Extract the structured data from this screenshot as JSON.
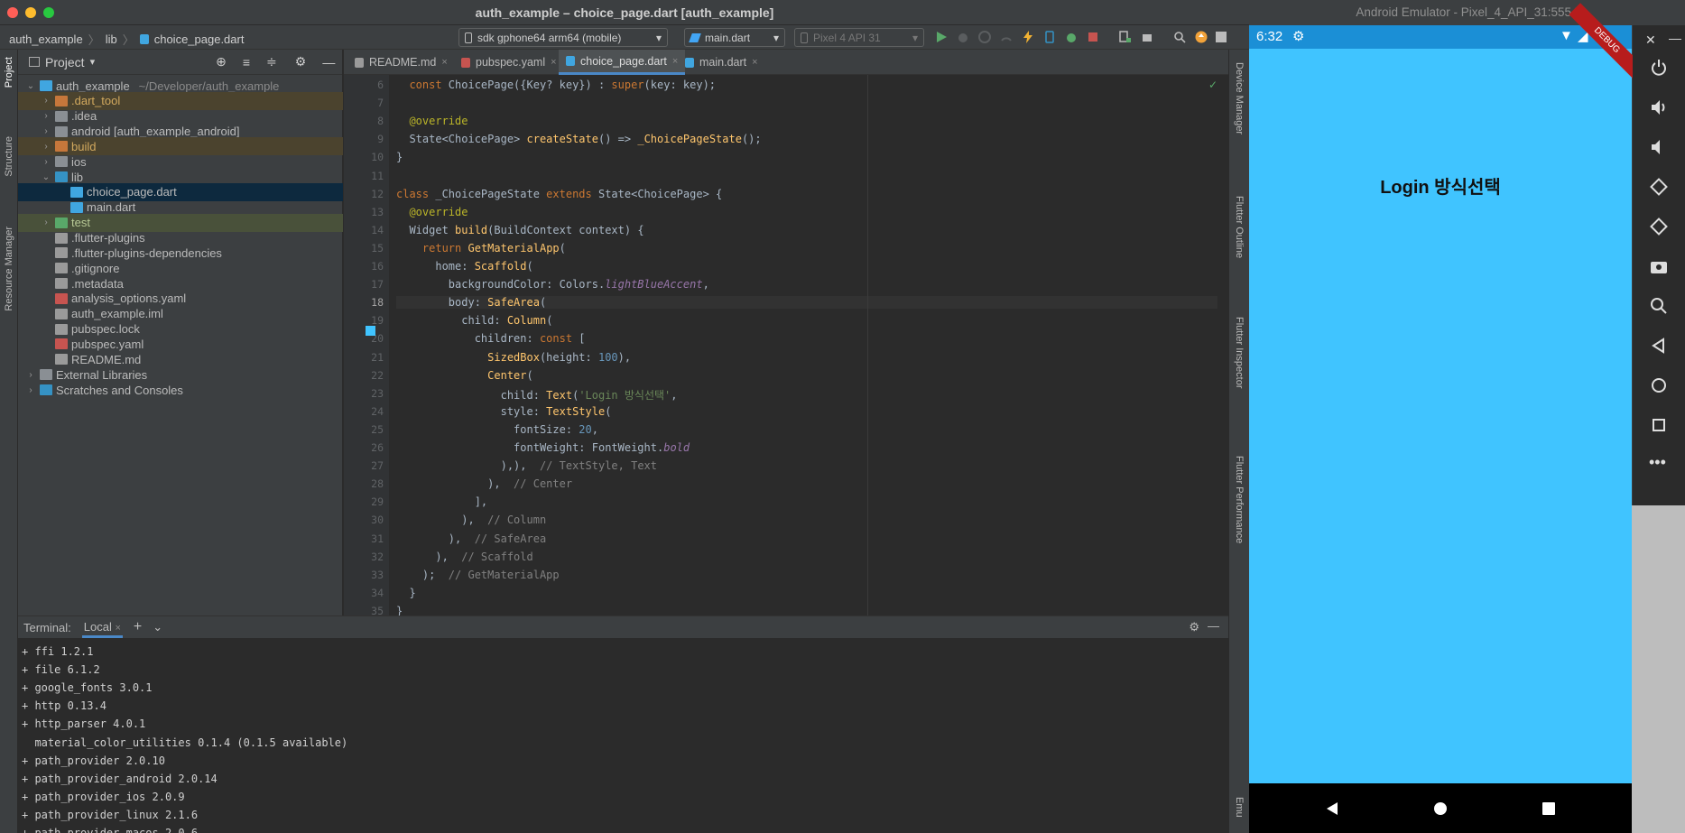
{
  "window": {
    "title": "auth_example – choice_page.dart [auth_example]"
  },
  "breadcrumb": [
    "auth_example",
    "lib",
    "choice_page.dart"
  ],
  "toolbar": {
    "device": "sdk gphone64 arm64 (mobile)",
    "run_config": "main.dart",
    "emulator": "Pixel 4 API 31"
  },
  "left_strip": {
    "project": "Project",
    "structure": "Structure",
    "resource_manager": "Resource Manager"
  },
  "right_strip": {
    "device_manager": "Device Manager",
    "flutter_outline": "Flutter Outline",
    "flutter_inspector": "Flutter Inspector",
    "flutter_performance": "Flutter Performance",
    "emulator": "Emu"
  },
  "project": {
    "header": "Project",
    "tree": [
      {
        "label": "auth_example",
        "extra": "~/Developer/auth_example",
        "level": 0,
        "arrow": "open",
        "icon": "module"
      },
      {
        "label": ".dart_tool",
        "level": 1,
        "arrow": "closed",
        "icon": "folder-orange"
      },
      {
        "label": ".idea",
        "level": 1,
        "arrow": "closed",
        "icon": "folder"
      },
      {
        "label": "android [auth_example_android]",
        "level": 1,
        "arrow": "closed",
        "icon": "folder"
      },
      {
        "label": "build",
        "level": 1,
        "arrow": "closed",
        "icon": "folder-orange"
      },
      {
        "label": "ios",
        "level": 1,
        "arrow": "closed",
        "icon": "folder"
      },
      {
        "label": "lib",
        "level": 1,
        "arrow": "open",
        "icon": "folder-blue"
      },
      {
        "label": "choice_page.dart",
        "level": 2,
        "arrow": "none",
        "icon": "dart"
      },
      {
        "label": "main.dart",
        "level": 2,
        "arrow": "none",
        "icon": "dart"
      },
      {
        "label": "test",
        "level": 1,
        "arrow": "closed",
        "icon": "folder-green"
      },
      {
        "label": ".flutter-plugins",
        "level": 1,
        "arrow": "none",
        "icon": "file"
      },
      {
        "label": ".flutter-plugins-dependencies",
        "level": 1,
        "arrow": "none",
        "icon": "file"
      },
      {
        "label": ".gitignore",
        "level": 1,
        "arrow": "none",
        "icon": "file"
      },
      {
        "label": ".metadata",
        "level": 1,
        "arrow": "none",
        "icon": "file"
      },
      {
        "label": "analysis_options.yaml",
        "level": 1,
        "arrow": "none",
        "icon": "yaml"
      },
      {
        "label": "auth_example.iml",
        "level": 1,
        "arrow": "none",
        "icon": "file"
      },
      {
        "label": "pubspec.lock",
        "level": 1,
        "arrow": "none",
        "icon": "file"
      },
      {
        "label": "pubspec.yaml",
        "level": 1,
        "arrow": "none",
        "icon": "yaml"
      },
      {
        "label": "README.md",
        "level": 1,
        "arrow": "none",
        "icon": "md"
      },
      {
        "label": "External Libraries",
        "level": 0,
        "arrow": "closed",
        "icon": "lib"
      },
      {
        "label": "Scratches and Consoles",
        "level": 0,
        "arrow": "closed",
        "icon": "scratch"
      }
    ]
  },
  "editor": {
    "tabs": [
      {
        "label": "README.md",
        "icon": "md"
      },
      {
        "label": "pubspec.yaml",
        "icon": "yaml"
      },
      {
        "label": "choice_page.dart",
        "icon": "dart"
      },
      {
        "label": "main.dart",
        "icon": "dart"
      }
    ],
    "active_tab": 2,
    "lines": [
      {
        "n": "6",
        "html": "  <span class=\"k\">const</span> ChoicePage({Key? key}) : <span class=\"k\">super</span>(key: key);"
      },
      {
        "n": "7",
        "html": ""
      },
      {
        "n": "8",
        "html": "  <span class=\"a\">@override</span>"
      },
      {
        "n": "9",
        "html": "  State&lt;ChoicePage&gt; <span class=\"f\">createState</span>() =&gt; <span class=\"f\">_ChoicePageState</span>();"
      },
      {
        "n": "10",
        "html": "}"
      },
      {
        "n": "11",
        "html": ""
      },
      {
        "n": "12",
        "html": "<span class=\"k\">class</span> _ChoicePageState <span class=\"k\">extends</span> State&lt;ChoicePage&gt; {"
      },
      {
        "n": "13",
        "html": "  <span class=\"a\">@override</span>"
      },
      {
        "n": "14",
        "html": "  Widget <span class=\"f\">build</span>(BuildContext context) {"
      },
      {
        "n": "15",
        "html": "    <span class=\"k\">return</span> <span class=\"f\">GetMaterialApp</span>("
      },
      {
        "n": "16",
        "html": "      home: <span class=\"f\">Scaffold</span>("
      },
      {
        "n": "17",
        "html": "        backgroundColor: Colors.<span class=\"p\">lightBlueAccent</span>,"
      },
      {
        "n": "18",
        "html": "        body: <span class=\"f\">SafeArea</span>("
      },
      {
        "n": "19",
        "html": "          child: <span class=\"f\">Column</span>("
      },
      {
        "n": "20",
        "html": "            children: <span class=\"k\">const</span> ["
      },
      {
        "n": "21",
        "html": "              <span class=\"f\">SizedBox</span>(height: <span class=\"n\">100</span>),"
      },
      {
        "n": "22",
        "html": "              <span class=\"f\">Center</span>("
      },
      {
        "n": "23",
        "html": "                child: <span class=\"f\">Text</span>(<span class=\"s\">'Login 방식선택'</span>,"
      },
      {
        "n": "24",
        "html": "                style: <span class=\"f\">TextStyle</span>("
      },
      {
        "n": "25",
        "html": "                  fontSize: <span class=\"n\">20</span>,"
      },
      {
        "n": "26",
        "html": "                  fontWeight: FontWeight.<span class=\"p\">bold</span>"
      },
      {
        "n": "27",
        "html": "                ),),  <span class=\"cm\">// TextStyle, Text</span>"
      },
      {
        "n": "28",
        "html": "              ),  <span class=\"cm\">// Center</span>"
      },
      {
        "n": "29",
        "html": "            ],"
      },
      {
        "n": "30",
        "html": "          ),  <span class=\"cm\">// Column</span>"
      },
      {
        "n": "31",
        "html": "        ),  <span class=\"cm\">// SafeArea</span>"
      },
      {
        "n": "32",
        "html": "      ),  <span class=\"cm\">// Scaffold</span>"
      },
      {
        "n": "33",
        "html": "    );  <span class=\"cm\">// GetMaterialApp</span>"
      },
      {
        "n": "34",
        "html": "  }"
      },
      {
        "n": "35",
        "html": "}"
      }
    ],
    "current_line": "18"
  },
  "terminal": {
    "label": "Terminal:",
    "tab": "Local",
    "lines": [
      "+ ffi 1.2.1",
      "+ file 6.1.2",
      "+ google_fonts 3.0.1",
      "+ http 0.13.4",
      "+ http_parser 4.0.1",
      "  material_color_utilities 0.1.4 (0.1.5 available)",
      "+ path_provider 2.0.10",
      "+ path_provider_android 2.0.14",
      "+ path_provider_ios 2.0.9",
      "+ path_provider_linux 2.1.6",
      "+ path_provider_macos 2.0.6"
    ]
  },
  "emulator": {
    "title": "Android Emulator - Pixel_4_API_31:5554",
    "time": "6:32",
    "debug_banner": "DEBUG",
    "page_title": "Login 방식선택",
    "app_background": "#40c4ff"
  },
  "colors": {
    "accent": "#4a88c7",
    "run": "#59a869",
    "stop": "#c75450"
  }
}
